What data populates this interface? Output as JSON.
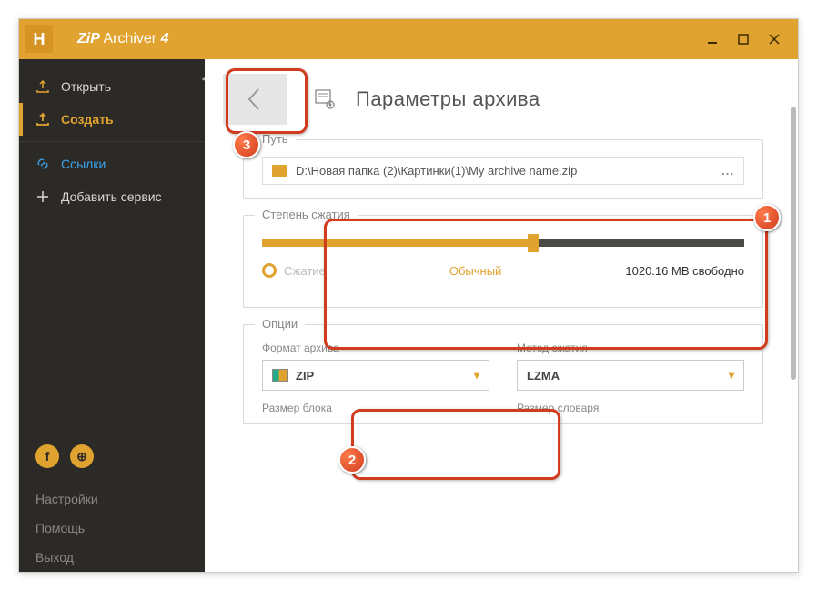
{
  "title": {
    "app": "ZiP",
    "suffix": "Archiver",
    "version": "4",
    "logo_letter": "H"
  },
  "sidebar": {
    "open": "Открыть",
    "create": "Создать",
    "links": "Ссылки",
    "add_service": "Добавить сервис",
    "settings": "Настройки",
    "help": "Помощь",
    "exit": "Выход",
    "social_fb": "f",
    "social_web": "⊕"
  },
  "page": {
    "title": "Параметры архива"
  },
  "path": {
    "legend": "Путь",
    "value": "D:\\Новая папка (2)\\Картинки(1)\\My archive name.zip",
    "more": "..."
  },
  "compression": {
    "legend": "Степень сжатия",
    "label": "Сжатие",
    "mode": "Обычный",
    "free": "1020.16 MB свободно"
  },
  "options": {
    "legend": "Опции",
    "format_label": "Формат архива",
    "format_value": "ZIP",
    "method_label": "Метод сжатия",
    "method_value": "LZMA",
    "block_label": "Размер блока",
    "dict_label": "Размер словаря"
  },
  "callouts": {
    "c1": "1",
    "c2": "2",
    "c3": "3"
  }
}
